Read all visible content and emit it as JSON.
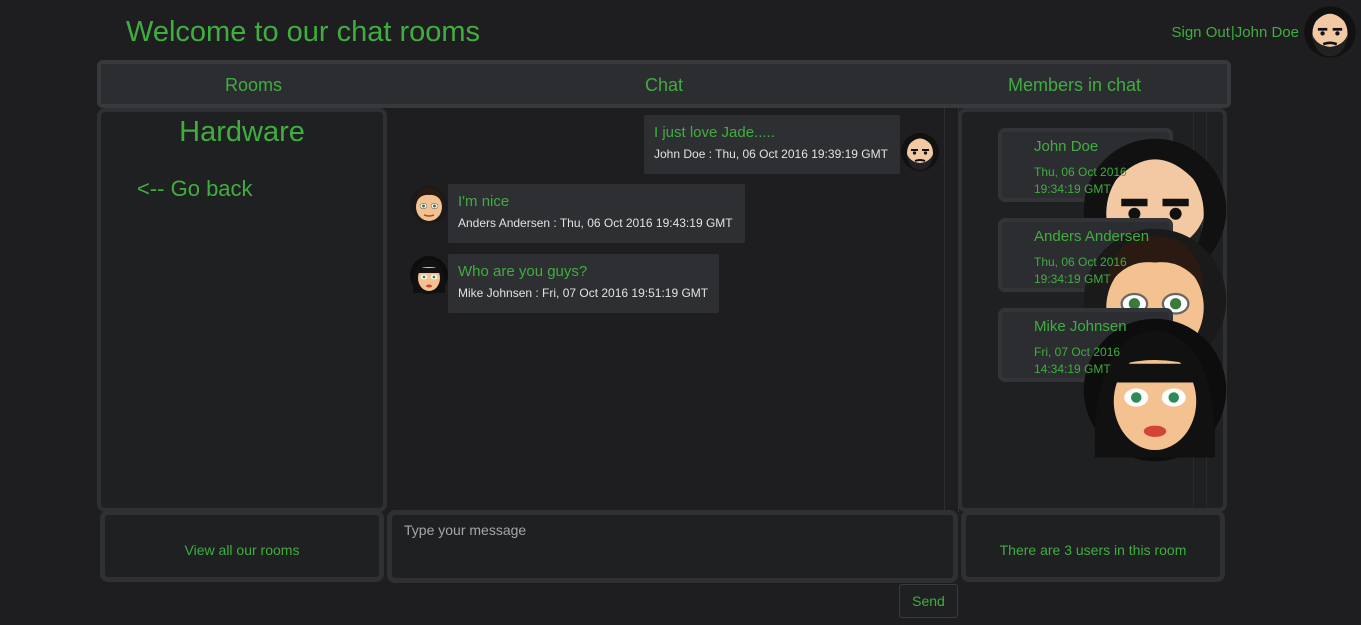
{
  "header": {
    "title": "Welcome to our chat rooms",
    "sign_out": "Sign Out",
    "separator": "|",
    "username": "John Doe"
  },
  "nav": {
    "rooms": "Rooms",
    "chat": "Chat",
    "members": "Members in chat"
  },
  "rooms_panel": {
    "room_name": "Hardware",
    "go_back": "<-- Go back",
    "footer": "View all our rooms"
  },
  "messages": [
    {
      "text": "I just love Jade.....",
      "author": "John Doe",
      "meta": "John Doe : Thu, 06 Oct 2016 19:39:19 GMT",
      "avatar": "bearded-man-avatar-icon"
    },
    {
      "text": "I'm nice",
      "author": "Anders Andersen",
      "meta": "Anders Andersen : Thu, 06 Oct 2016 19:43:19 GMT",
      "avatar": "man-avatar-icon"
    },
    {
      "text": "Who are you guys?",
      "author": "Mike Johnsen",
      "meta": "Mike Johnsen : Fri, 07 Oct 2016 19:51:19 GMT",
      "avatar": "woman-avatar-icon"
    }
  ],
  "members": [
    {
      "name": "John Doe",
      "date1": "Thu, 06 Oct 2016",
      "date2": "19:34:19 GMT"
    },
    {
      "name": "Anders Andersen",
      "date1": "Thu, 06 Oct 2016",
      "date2": "19:34:19 GMT"
    },
    {
      "name": "Mike Johnsen",
      "date1": "Fri, 07 Oct 2016",
      "date2": "14:34:19 GMT"
    }
  ],
  "members_footer": "There are 3 users in this room",
  "composer": {
    "placeholder": "Type your message",
    "value": "",
    "send_label": "Send"
  },
  "colors": {
    "accent": "#3fae3f",
    "background": "#1e1e20",
    "panel": "#2c2d30"
  }
}
